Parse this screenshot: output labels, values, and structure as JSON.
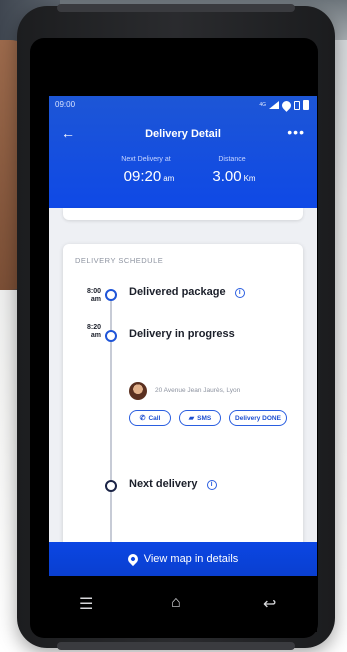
{
  "status": {
    "time": "09:00",
    "network_label": "4G"
  },
  "header": {
    "title": "Delivery Detail",
    "next_delivery_label": "Next Delivery at",
    "next_delivery_value": "09:20",
    "next_delivery_unit": "am",
    "distance_label": "Distance",
    "distance_value": "3.00",
    "distance_unit": "Km"
  },
  "schedule": {
    "title": "DELIVERY SCHEDULE",
    "items": [
      {
        "time": "8:00",
        "ampm": "am",
        "title": "Delivered package"
      },
      {
        "time": "8:20",
        "ampm": "am",
        "title": "Delivery in progress",
        "address": "20 Avenue Jean Jaurès, Lyon"
      },
      {
        "time": "",
        "ampm": "",
        "title": "Next delivery"
      }
    ],
    "buttons": {
      "call": "Call",
      "sms": "SMS",
      "done": "Delivery DONE"
    }
  },
  "footer": {
    "map_label": "View map in details"
  },
  "colors": {
    "primary": "#0f49e6",
    "accent": "#2a5ee0",
    "node_dark": "#1b2446"
  },
  "icons": {
    "back": "back-arrow-icon",
    "more": "more-dots-icon",
    "info": "info-icon",
    "call": "phone-icon",
    "sms": "message-icon",
    "pin": "map-pin-icon",
    "nav_menu": "menu-icon",
    "nav_home": "home-icon",
    "nav_back": "back-nav-icon"
  }
}
